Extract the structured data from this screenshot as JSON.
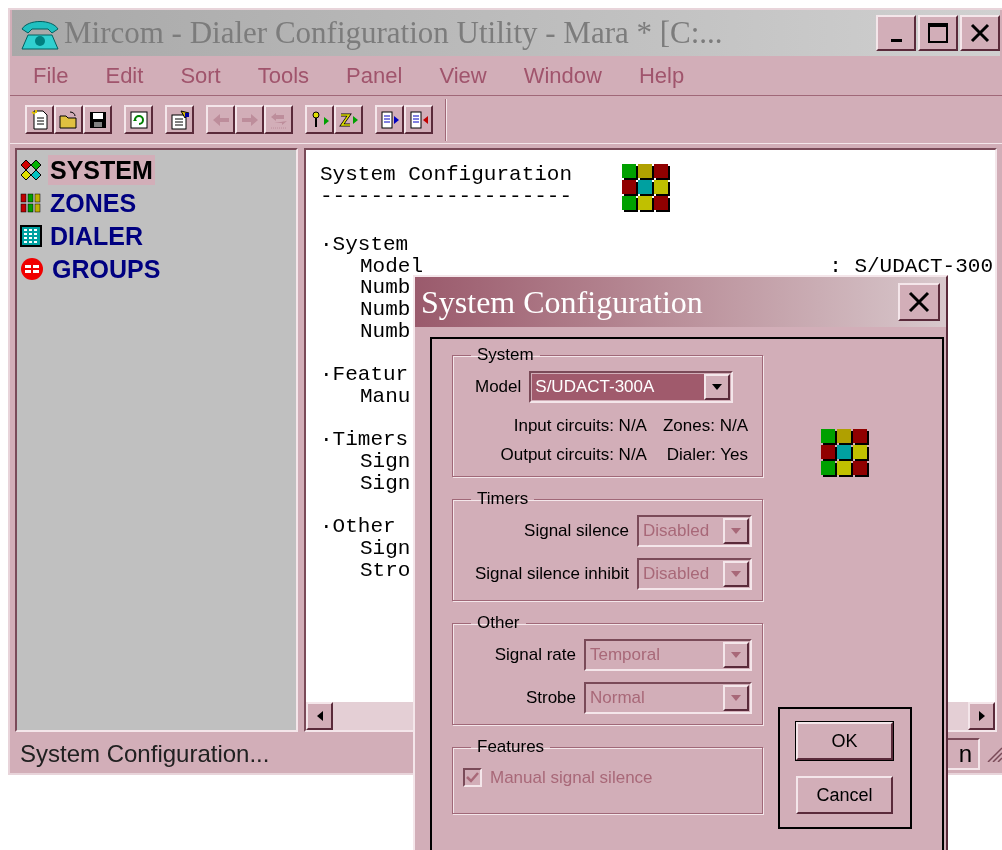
{
  "main_window": {
    "title": "Mircom - Dialer Configuration Utility - Mara * [C:...",
    "controls": [
      {
        "kind": "minimize"
      },
      {
        "kind": "maximize"
      },
      {
        "kind": "close"
      }
    ]
  },
  "menu": [
    "File",
    "Edit",
    "Sort",
    "Tools",
    "Panel",
    "View",
    "Window",
    "Help"
  ],
  "toolbar": [
    [
      {
        "kind": "new",
        "disabled": false
      },
      {
        "kind": "open",
        "disabled": false
      },
      {
        "kind": "save",
        "disabled": false
      }
    ],
    [
      {
        "kind": "refresh",
        "disabled": false
      }
    ],
    [
      {
        "kind": "properties",
        "disabled": false
      }
    ],
    [
      {
        "kind": "arrow-left",
        "disabled": true
      },
      {
        "kind": "arrow-right",
        "disabled": true
      },
      {
        "kind": "transfer",
        "disabled": true
      }
    ],
    [
      {
        "kind": "key-in",
        "disabled": false
      },
      {
        "kind": "z-in",
        "disabled": false
      }
    ],
    [
      {
        "kind": "doc-out",
        "disabled": false
      },
      {
        "kind": "doc-in",
        "disabled": false
      }
    ]
  ],
  "sidebar": {
    "items": [
      {
        "label": "SYSTEM",
        "kind": "system",
        "selected": true
      },
      {
        "label": "ZONES",
        "kind": "zones",
        "selected": false
      },
      {
        "label": "DIALER",
        "kind": "dialer",
        "selected": false
      },
      {
        "label": "GROUPS",
        "kind": "groups",
        "selected": false
      }
    ]
  },
  "document": {
    "heading": "System Configuration",
    "rule": "--------------------",
    "sections": [
      {
        "title": "·System",
        "items": [
          {
            "label": "Model",
            "value": ": S/UDACT-300"
          },
          {
            "label": "Numb"
          },
          {
            "label": "Numb"
          },
          {
            "label": "Numb"
          }
        ]
      },
      {
        "title": "·Featur",
        "items": [
          {
            "label": "Manu"
          }
        ]
      },
      {
        "title": "·Timers",
        "items": [
          {
            "label": "Sign"
          },
          {
            "label": "Sign"
          }
        ]
      },
      {
        "title": "·Other",
        "items": [
          {
            "label": "Sign"
          },
          {
            "label": "Stro"
          }
        ]
      }
    ]
  },
  "status_bar": {
    "text": "System Configuration...",
    "panel_2": "n"
  },
  "dialog": {
    "title": "System Configuration",
    "system_group": {
      "legend": "System",
      "model": {
        "label": "Model",
        "value": "S/UDACT-300A",
        "disabled": false
      },
      "info": [
        [
          "Input circuits: N/A",
          "Zones: N/A"
        ],
        [
          "Output circuits: N/A",
          "Dialer: Yes"
        ]
      ]
    },
    "timers_group": {
      "legend": "Timers",
      "fields": [
        {
          "label": "Signal silence",
          "value": "Disabled",
          "disabled": true
        },
        {
          "label": "Signal silence inhibit",
          "value": "Disabled",
          "disabled": true
        }
      ]
    },
    "other_group": {
      "legend": "Other",
      "fields": [
        {
          "label": "Signal rate",
          "value": "Temporal",
          "disabled": true
        },
        {
          "label": "Strobe",
          "value": "Normal",
          "disabled": true
        }
      ]
    },
    "features_group": {
      "legend": "Features",
      "checkbox": {
        "label": "Manual signal silence",
        "checked": true,
        "disabled": true
      }
    },
    "buttons": [
      "OK",
      "Cancel"
    ]
  }
}
